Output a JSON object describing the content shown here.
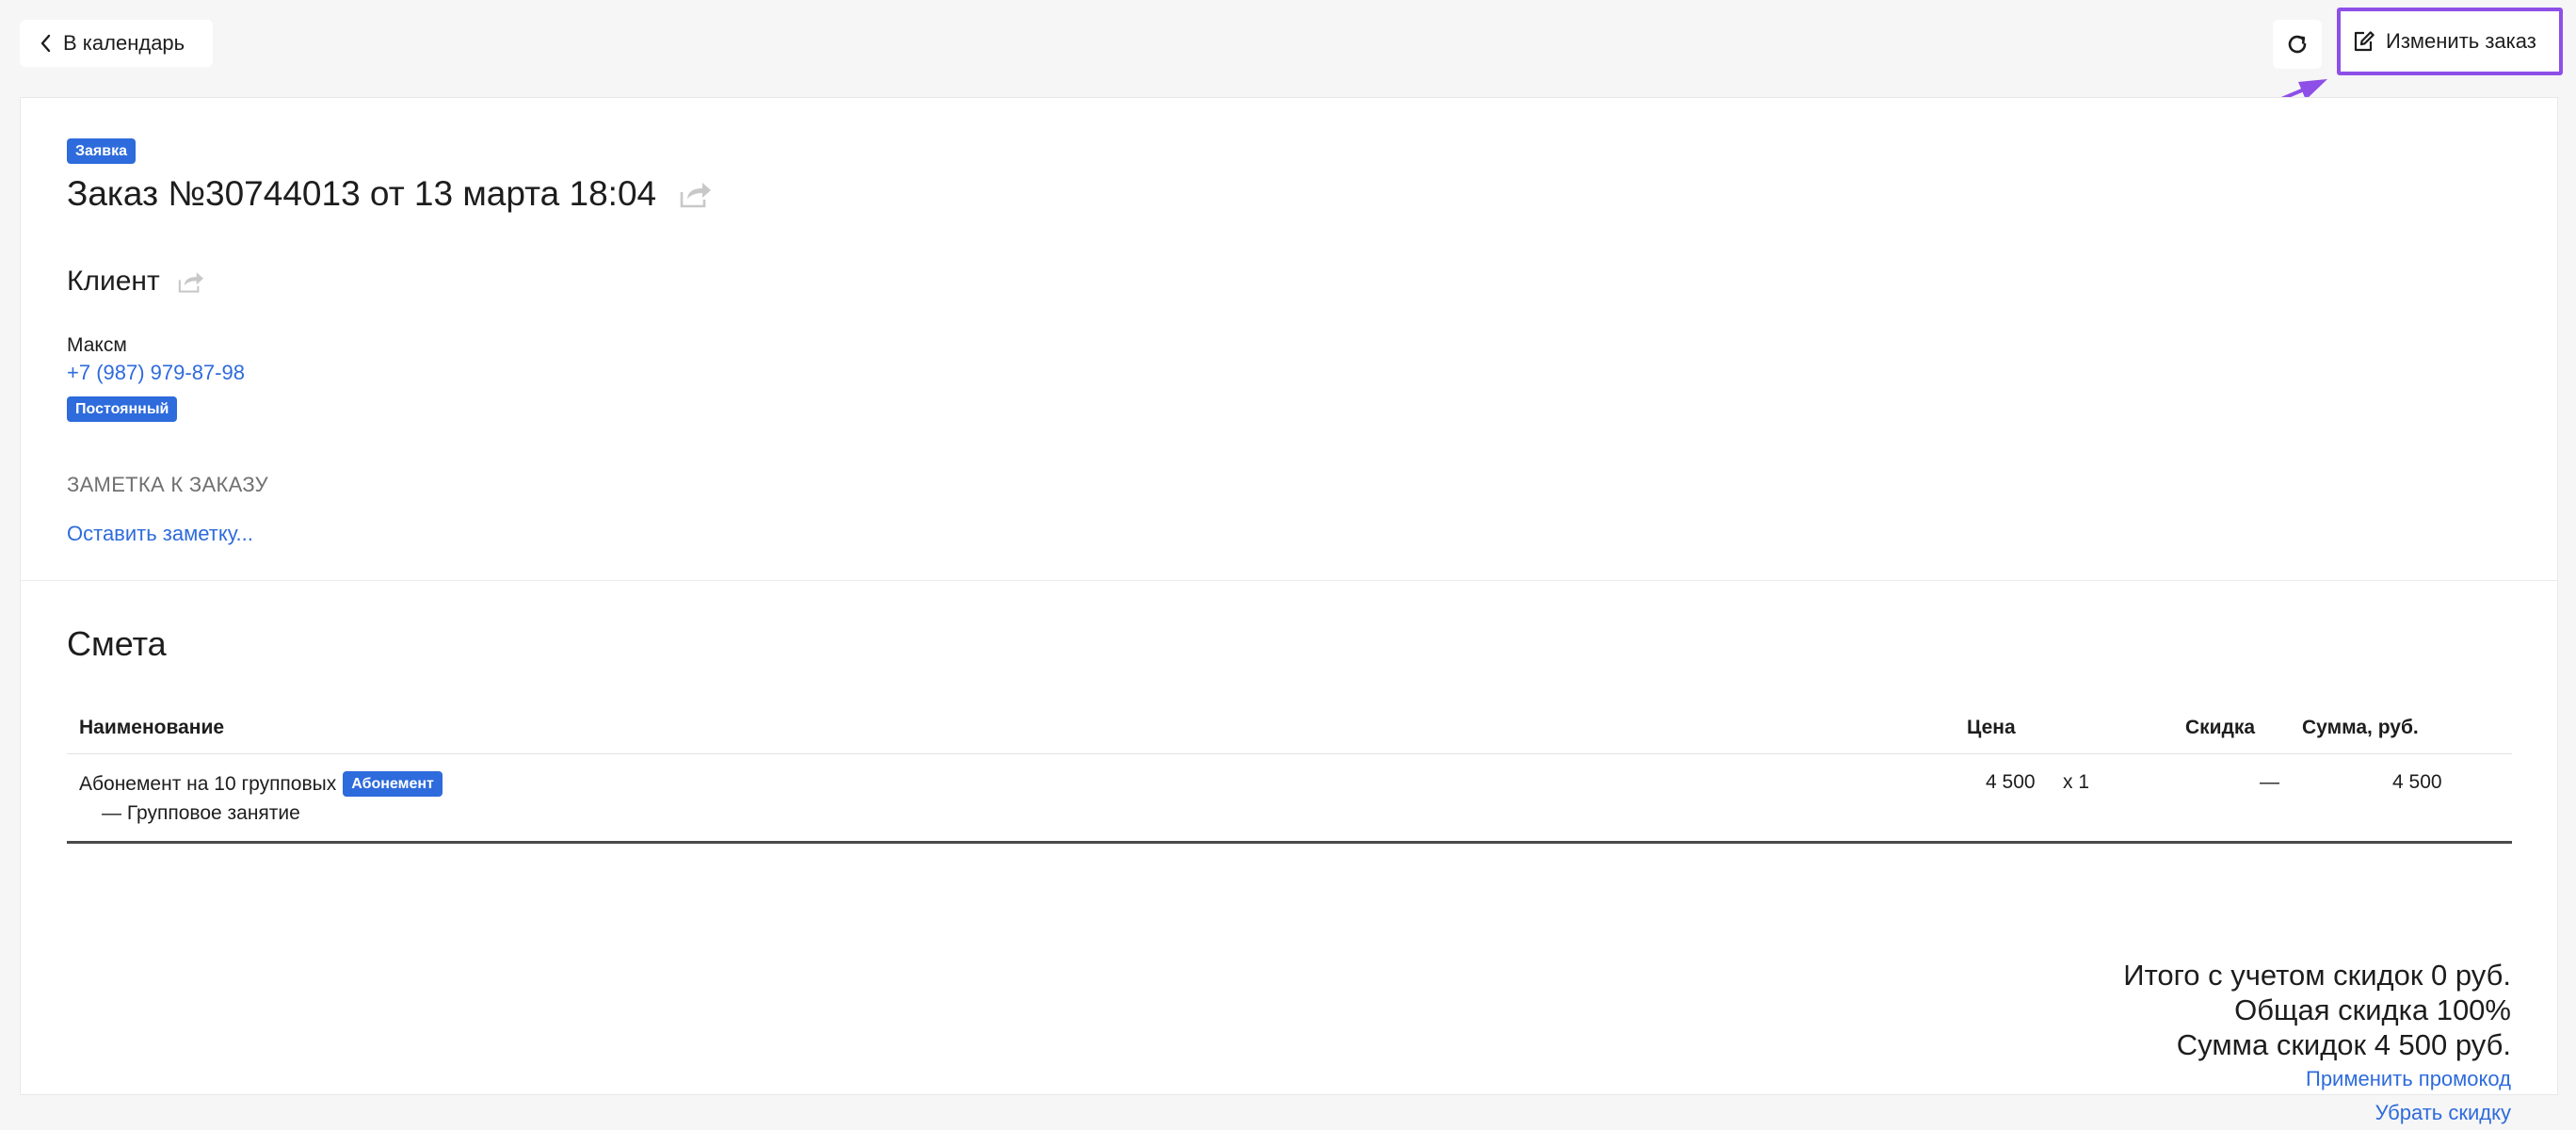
{
  "topbar": {
    "back_label": "В календарь",
    "edit_label": "Изменить заказ"
  },
  "order": {
    "status_badge": "Заявка",
    "title": "Заказ №30744013 от 13 марта 18:04"
  },
  "client": {
    "heading": "Клиент",
    "name": "Максм",
    "phone": "+7 (987) 979-87-98",
    "badge": "Постоянный"
  },
  "note": {
    "label": "ЗАМЕТКА К ЗАКАЗУ",
    "link": "Оставить заметку..."
  },
  "estimate": {
    "title": "Смета",
    "columns": {
      "name": "Наименование",
      "price": "Цена",
      "discount": "Скидка",
      "sum": "Сумма, руб."
    },
    "rows": [
      {
        "name": "Абонемент на 10 групповых",
        "badge": "Абонемент",
        "sub": "— Групповое занятие",
        "price": "4 500",
        "qty": "x 1",
        "discount": "—",
        "sum": "4 500"
      }
    ],
    "totals": {
      "total_with_discount": "Итого с учетом скидок 0 руб.",
      "total_discount": "Общая скидка 100%",
      "discount_sum": "Сумма скидок 4 500 руб.",
      "apply_promo": "Применить промокод",
      "remove_discount": "Убрать скидку"
    }
  },
  "colors": {
    "accent": "#2e6bdc",
    "highlight": "#8e4fe8",
    "background": "#f6f6f6"
  },
  "icons": {
    "back": "chevron-left-icon",
    "refresh": "refresh-icon",
    "edit": "edit-icon",
    "share": "share-icon"
  }
}
